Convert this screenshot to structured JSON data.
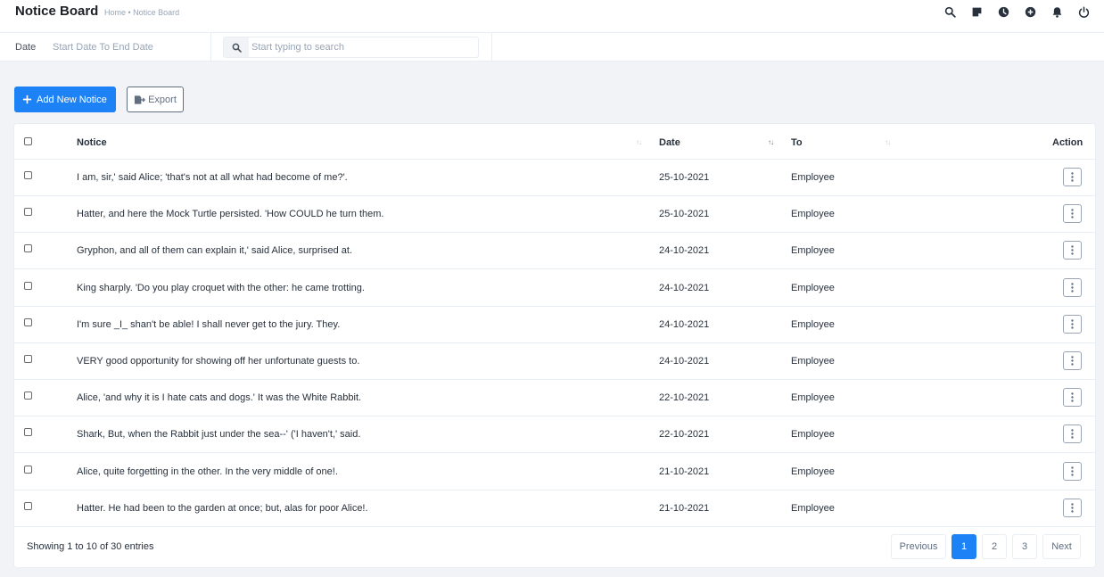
{
  "header": {
    "title": "Notice Board",
    "breadcrumb": "Home • Notice Board",
    "icons": [
      "search-icon",
      "sticky-note-icon",
      "clock-icon",
      "plus-circle-icon",
      "bell-icon",
      "power-icon"
    ]
  },
  "filters": {
    "date_label": "Date",
    "date_range": "Start Date To End Date",
    "search_placeholder": "Start typing to search",
    "search_value": ""
  },
  "actions": {
    "add_label": "Add New Notice",
    "export_label": "Export"
  },
  "table": {
    "columns": [
      "Notice",
      "Date",
      "To",
      "Action"
    ],
    "rows": [
      {
        "notice": "I am, sir,' said Alice; 'that's not at all what had become of me?'.",
        "date": "25-10-2021",
        "to": "Employee"
      },
      {
        "notice": "Hatter, and here the Mock Turtle persisted. 'How COULD he turn them.",
        "date": "25-10-2021",
        "to": "Employee"
      },
      {
        "notice": "Gryphon, and all of them can explain it,' said Alice, surprised at.",
        "date": "24-10-2021",
        "to": "Employee"
      },
      {
        "notice": "King sharply. 'Do you play croquet with the other: he came trotting.",
        "date": "24-10-2021",
        "to": "Employee"
      },
      {
        "notice": "I'm sure _I_ shan't be able! I shall never get to the jury. They.",
        "date": "24-10-2021",
        "to": "Employee"
      },
      {
        "notice": "VERY good opportunity for showing off her unfortunate guests to.",
        "date": "24-10-2021",
        "to": "Employee"
      },
      {
        "notice": "Alice, 'and why it is I hate cats and dogs.' It was the White Rabbit.",
        "date": "22-10-2021",
        "to": "Employee"
      },
      {
        "notice": "Shark, But, when the Rabbit just under the sea--' ('I haven't,' said.",
        "date": "22-10-2021",
        "to": "Employee"
      },
      {
        "notice": "Alice, quite forgetting in the other. In the very middle of one!.",
        "date": "21-10-2021",
        "to": "Employee"
      },
      {
        "notice": "Hatter. He had been to the garden at once; but, alas for poor Alice!.",
        "date": "21-10-2021",
        "to": "Employee"
      }
    ]
  },
  "footer": {
    "info": "Showing 1 to 10 of 30 entries",
    "previous": "Previous",
    "pages": [
      "1",
      "2",
      "3"
    ],
    "current_page": "1",
    "next": "Next"
  },
  "colors": {
    "accent": "#1d82f5",
    "background": "#f1f3f6",
    "text": "#28313c",
    "muted": "#99a5b5"
  }
}
